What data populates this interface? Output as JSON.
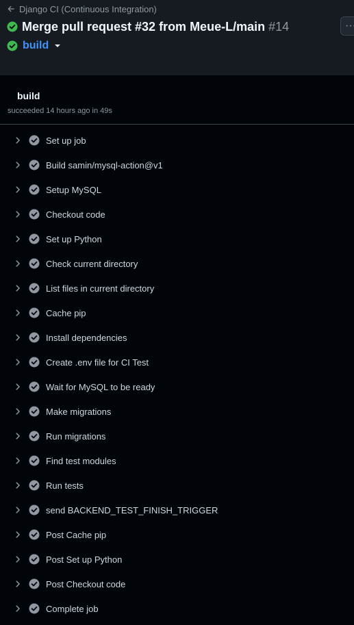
{
  "header": {
    "back_label": "Django CI (Continuous Integration)",
    "title": "Merge pull request #32 from Meue-L/main",
    "run_number": "#14",
    "more_label": "···",
    "job_name": "build"
  },
  "job": {
    "heading": "build",
    "status": "succeeded 14 hours ago in 49s"
  },
  "steps": [
    {
      "label": "Set up job"
    },
    {
      "label": "Build samin/mysql-action@v1"
    },
    {
      "label": "Setup MySQL"
    },
    {
      "label": "Checkout code"
    },
    {
      "label": "Set up Python"
    },
    {
      "label": "Check current directory"
    },
    {
      "label": "List files in current directory"
    },
    {
      "label": "Cache pip"
    },
    {
      "label": "Install dependencies"
    },
    {
      "label": "Create .env file for CI Test"
    },
    {
      "label": "Wait for MySQL to be ready"
    },
    {
      "label": "Make migrations"
    },
    {
      "label": "Run migrations"
    },
    {
      "label": "Find test modules"
    },
    {
      "label": "Run tests"
    },
    {
      "label": "send BACKEND_TEST_FINISH_TRIGGER"
    },
    {
      "label": "Post Cache pip"
    },
    {
      "label": "Post Set up Python"
    },
    {
      "label": "Post Checkout code"
    },
    {
      "label": "Complete job"
    }
  ],
  "colors": {
    "success": "#3fb950",
    "step_check": "#9198a1",
    "link": "#4493f8"
  }
}
